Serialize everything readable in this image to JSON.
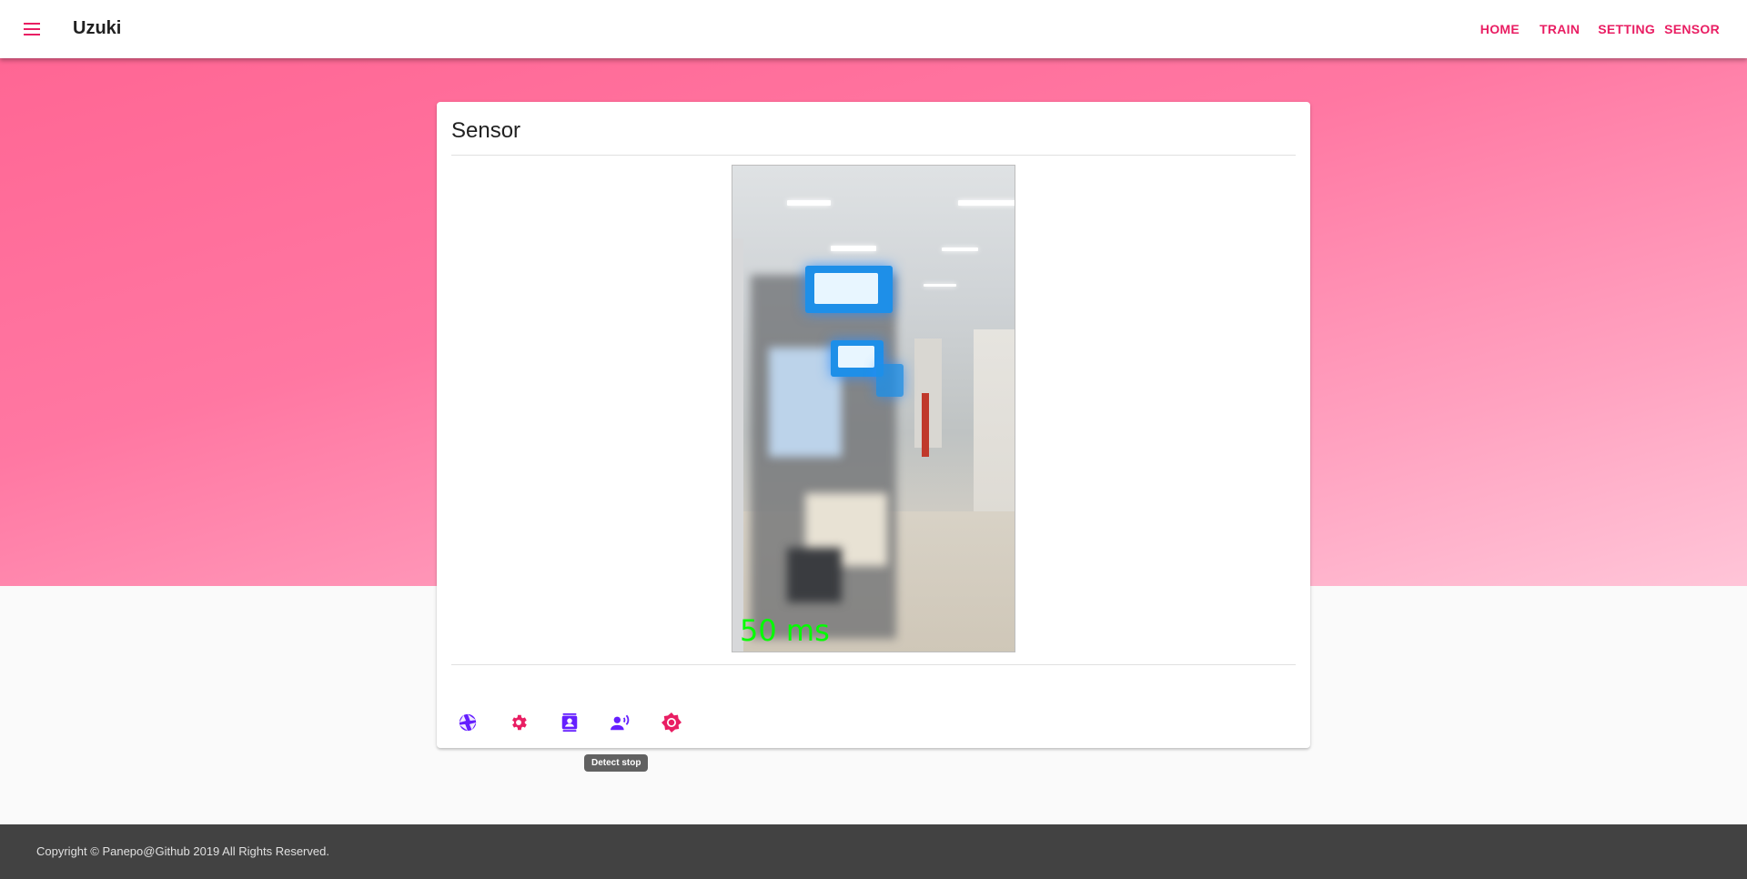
{
  "app": {
    "title": "Uzuki",
    "accent_color": "#e91e63",
    "secondary_color": "#651fff"
  },
  "nav": {
    "items": [
      {
        "label": "HOME"
      },
      {
        "label": "TRAIN"
      },
      {
        "label": "SETTING"
      },
      {
        "label": "SENSOR"
      }
    ]
  },
  "card": {
    "title": "Sensor",
    "camera": {
      "overlay_text": "50 ms"
    },
    "actions": [
      {
        "icon": "camera-iris-icon",
        "color": "#651fff"
      },
      {
        "icon": "gear-icon",
        "color": "#e91e63"
      },
      {
        "icon": "contacts-icon",
        "color": "#651fff"
      },
      {
        "icon": "voice-person-icon",
        "color": "#651fff"
      },
      {
        "icon": "brightness-icon",
        "color": "#e91e63"
      }
    ]
  },
  "tooltip": {
    "text": "Detect stop"
  },
  "footer": {
    "copyright": "Copyright © Panepo@Github 2019 All Rights Reserved."
  }
}
